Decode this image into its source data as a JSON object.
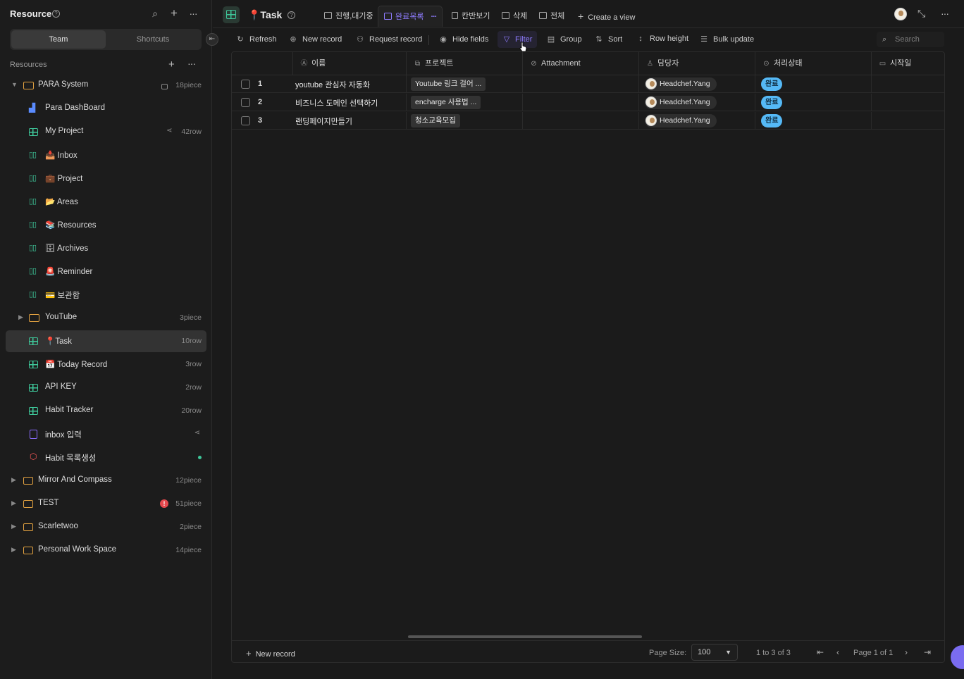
{
  "sidebar": {
    "title": "Resource",
    "segments": [
      "Team",
      "Shortcuts"
    ],
    "resources_label": "Resources",
    "items": [
      {
        "label": "PARA System",
        "meta": "18piece"
      },
      {
        "label": "Para DashBoard",
        "meta": ""
      },
      {
        "label": "My Project",
        "meta": "42row"
      },
      {
        "label": "📥 Inbox",
        "meta": ""
      },
      {
        "label": "💼 Project",
        "meta": ""
      },
      {
        "label": "📂 Areas",
        "meta": ""
      },
      {
        "label": "📚 Resources",
        "meta": ""
      },
      {
        "label": "🗄 Archives",
        "meta": ""
      },
      {
        "label": "🚨 Reminder",
        "meta": ""
      },
      {
        "label": "💳 보관함",
        "meta": ""
      },
      {
        "label": "YouTube",
        "meta": "3piece"
      },
      {
        "label": "📍Task",
        "meta": "10row"
      },
      {
        "label": "📅 Today Record",
        "meta": "3row"
      },
      {
        "label": "API KEY",
        "meta": "2row"
      },
      {
        "label": "Habit Tracker",
        "meta": "20row"
      },
      {
        "label": "inbox 입력",
        "meta": ""
      },
      {
        "label": "Habit 목록생성",
        "meta": ""
      },
      {
        "label": "Mirror And Compass",
        "meta": "12piece"
      },
      {
        "label": "TEST",
        "meta": "51piece"
      },
      {
        "label": "Scarletwoo",
        "meta": "2piece"
      },
      {
        "label": "Personal Work Space",
        "meta": "14piece"
      }
    ]
  },
  "topbar": {
    "title": "📍Task",
    "tabs": [
      "진행,대기중",
      "완료목록",
      "칸반보기",
      "삭제",
      "전체"
    ],
    "create_view": "Create a view"
  },
  "toolbar": {
    "refresh": "Refresh",
    "new_record": "New record",
    "request_record": "Request record",
    "hide_fields": "Hide fields",
    "filter": "Filter",
    "group": "Group",
    "sort": "Sort",
    "row_height": "Row height",
    "bulk_update": "Bulk update",
    "search_placeholder": "Search"
  },
  "table": {
    "columns": [
      "이름",
      "프로젝트",
      "Attachment",
      "담당자",
      "처리상태",
      "시작일"
    ],
    "rows": [
      {
        "num": "1",
        "name": "youtube 관심자 자동화",
        "project": "Youtube 링크 걸어 ...",
        "owner": "Headchef.Yang",
        "status": "완료"
      },
      {
        "num": "2",
        "name": "비즈니스 도메인 선택하기",
        "project": "encharge 사용법 ...",
        "owner": "Headchef.Yang",
        "status": "완료"
      },
      {
        "num": "3",
        "name": "랜딩페이지만들기",
        "project": "청소교육모집",
        "owner": "Headchef.Yang",
        "status": "완료"
      }
    ]
  },
  "footer": {
    "new_record": "New record",
    "page_size_label": "Page Size:",
    "page_size": "100",
    "range": "1 to 3 of 3",
    "page": "Page 1 of 1"
  },
  "colors": {
    "accent": "#8f7cff",
    "grid_icon": "#3ec79a",
    "status_done": "#55b9f6"
  }
}
